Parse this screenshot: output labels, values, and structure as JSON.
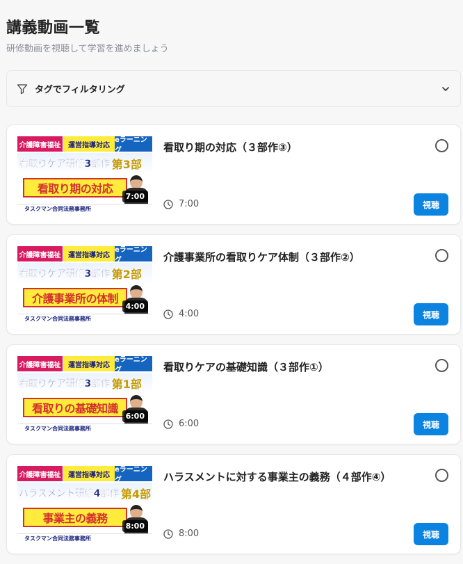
{
  "header": {
    "title": "講義動画一覧",
    "subtitle": "研修動画を視聴して学習を進めましょう"
  },
  "filter": {
    "label": "タグでフィルタリング",
    "icon": "filter-icon",
    "toggle_icon": "chevron-down-icon"
  },
  "accent_color": "#0a84e0",
  "thumbnail_common": {
    "tag_a": "介護障害福祉",
    "tag_b": "運営指導対応",
    "tag_c": "eラーニング",
    "footer": "タスクマン合同法務事務所"
  },
  "videos": [
    {
      "title": "看取り期の対応（３部作③）",
      "duration": "7:00",
      "thumb_series": "看取りケア研修3部作",
      "thumb_part": "第3部",
      "thumb_title": "看取り期の対応",
      "watch_label": "視聴"
    },
    {
      "title": "介護事業所の看取りケア体制（３部作②）",
      "duration": "4:00",
      "thumb_series": "看取りケア研修3部作",
      "thumb_part": "第2部",
      "thumb_title": "介護事業所の体制",
      "watch_label": "視聴"
    },
    {
      "title": "看取りケアの基礎知識（３部作①）",
      "duration": "6:00",
      "thumb_series": "看取りケア研修3部作",
      "thumb_part": "第1部",
      "thumb_title": "看取りの基礎知識",
      "watch_label": "視聴"
    },
    {
      "title": "ハラスメントに対する事業主の義務（４部作④）",
      "duration": "8:00",
      "thumb_series": "ハラスメント研修4部作",
      "thumb_part": "第4部",
      "thumb_title": "事業主の義務",
      "watch_label": "視聴"
    }
  ]
}
